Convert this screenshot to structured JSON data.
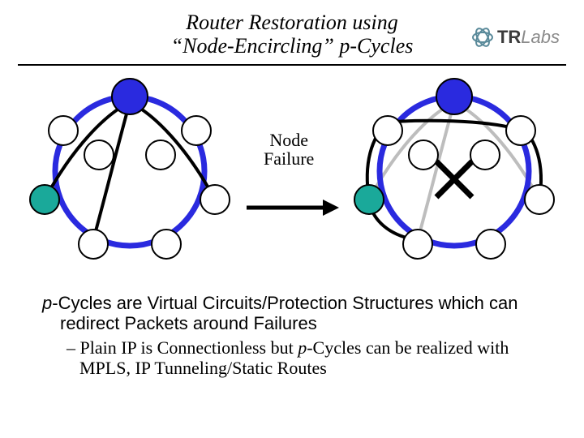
{
  "title_line1": "Router Restoration using",
  "title_line2": "“Node-Encircling” p-Cycles",
  "logo": {
    "tr": "TR",
    "labs": "Labs"
  },
  "label_node_failure_line1": "Node",
  "label_node_failure_line2": "Failure",
  "body_lead_prefix": "p",
  "body_lead_rest": "-Cycles are Virtual Circuits/Protection Structures which can redirect Packets around Failures",
  "body_sub_prefix": "– Plain IP is Connectionless but ",
  "body_sub_italic": "p",
  "body_sub_rest": "-Cycles can be realized with MPLS, IP Tunneling/Static Routes"
}
